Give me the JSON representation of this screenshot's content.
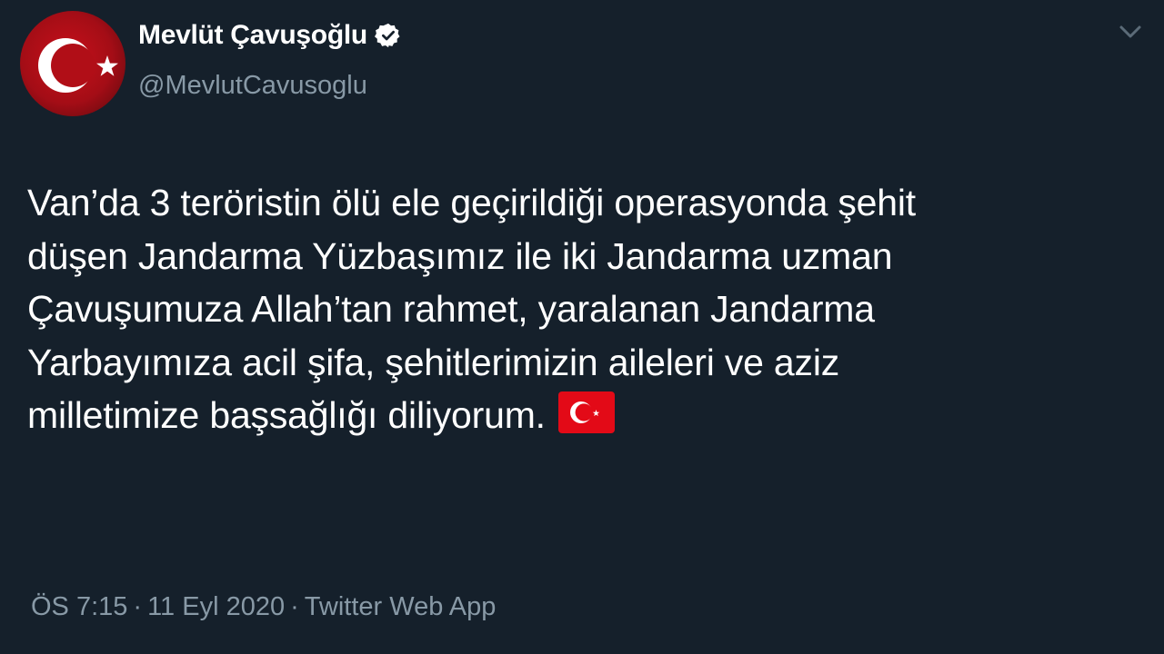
{
  "author": {
    "display_name": "Mevlüt Çavuşoğlu",
    "handle": "@MevlutCavusoglu",
    "verified": true,
    "avatar_icon": "turkish-flag-avatar-icon"
  },
  "tweet": {
    "lines": [
      "Van’da 3 teröristin ölü ele geçirildiği operasyonda şehit",
      "düşen Jandarma Yüzbaşımız ile iki Jandarma uzman",
      "Çavuşumuza Allah’tan rahmet, yaralanan Jandarma",
      "Yarbayımıza acil şifa, şehitlerimizin aileleri ve aziz",
      "milletimize başsağlığı diliyorum."
    ],
    "emoji": "turkish-flag-emoji"
  },
  "meta": {
    "time": "ÖS 7:15",
    "separator": "·",
    "date": "11 Eyl 2020",
    "source": "Twitter Web App"
  },
  "colors": {
    "background": "#15202b",
    "text": "#ffffff",
    "secondary_text": "#8899a6",
    "flag_red": "#e30a17",
    "verified": "#ffffff"
  }
}
